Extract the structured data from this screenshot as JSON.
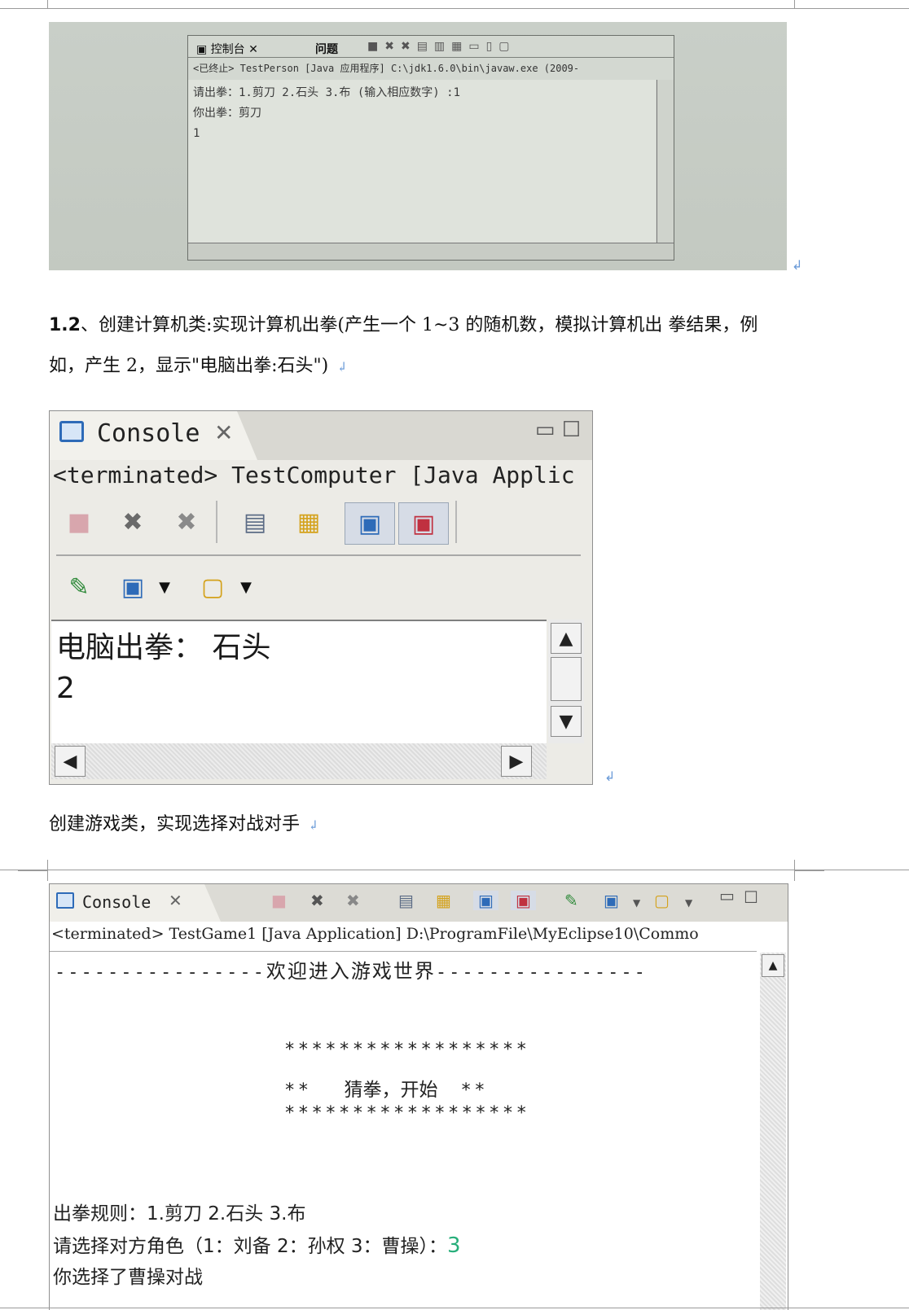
{
  "photo_console": {
    "tab_console": "控制台",
    "tab_problems": "问题",
    "path": "<已终止> TestPerson [Java 应用程序] C:\\jdk1.6.0\\bin\\javaw.exe (2009-",
    "lines": [
      "请出拳：1.剪刀 2.石头 3.布 (输入相应数字) :1",
      "你出拳：剪刀",
      "1"
    ]
  },
  "section_1_2": {
    "number": "1.2",
    "text_line1": "、创建计算机类:实现计算机出拳(产生一个 1~3 的随机数，模拟计算机出 拳结果，例",
    "text_line2": "如，产生 2，显示\"电脑出拳:石头\")"
  },
  "console2": {
    "tab_label": "Console",
    "path": "<terminated> TestComputer [Java Applic",
    "output_line1": "电脑出拳： 石头",
    "output_line2": "2"
  },
  "section_game": {
    "text": "创建游戏类，实现选择对战对手"
  },
  "console3": {
    "tab_label": "Console",
    "path": "<terminated> TestGame1 [Java Application] D:\\ProgramFile\\MyEclipse10\\Commo",
    "banner_left": "----------------",
    "banner_title": "欢迎进入游戏世界",
    "banner_right": "----------------",
    "stars_top": "******************",
    "stars_mid_left": "**",
    "stars_mid_text": "猜拳，开始",
    "stars_mid_right": "**",
    "stars_bottom": "******************",
    "rules_label": "出拳规则：",
    "rules_value": "1.剪刀 2.石头 3.布",
    "choose_prompt": "请选择对方角色（1：刘备 2：孙权 3：曹操）：",
    "choose_input": "3",
    "chosen": "你选择了曹操对战"
  },
  "return_mark": "↲"
}
